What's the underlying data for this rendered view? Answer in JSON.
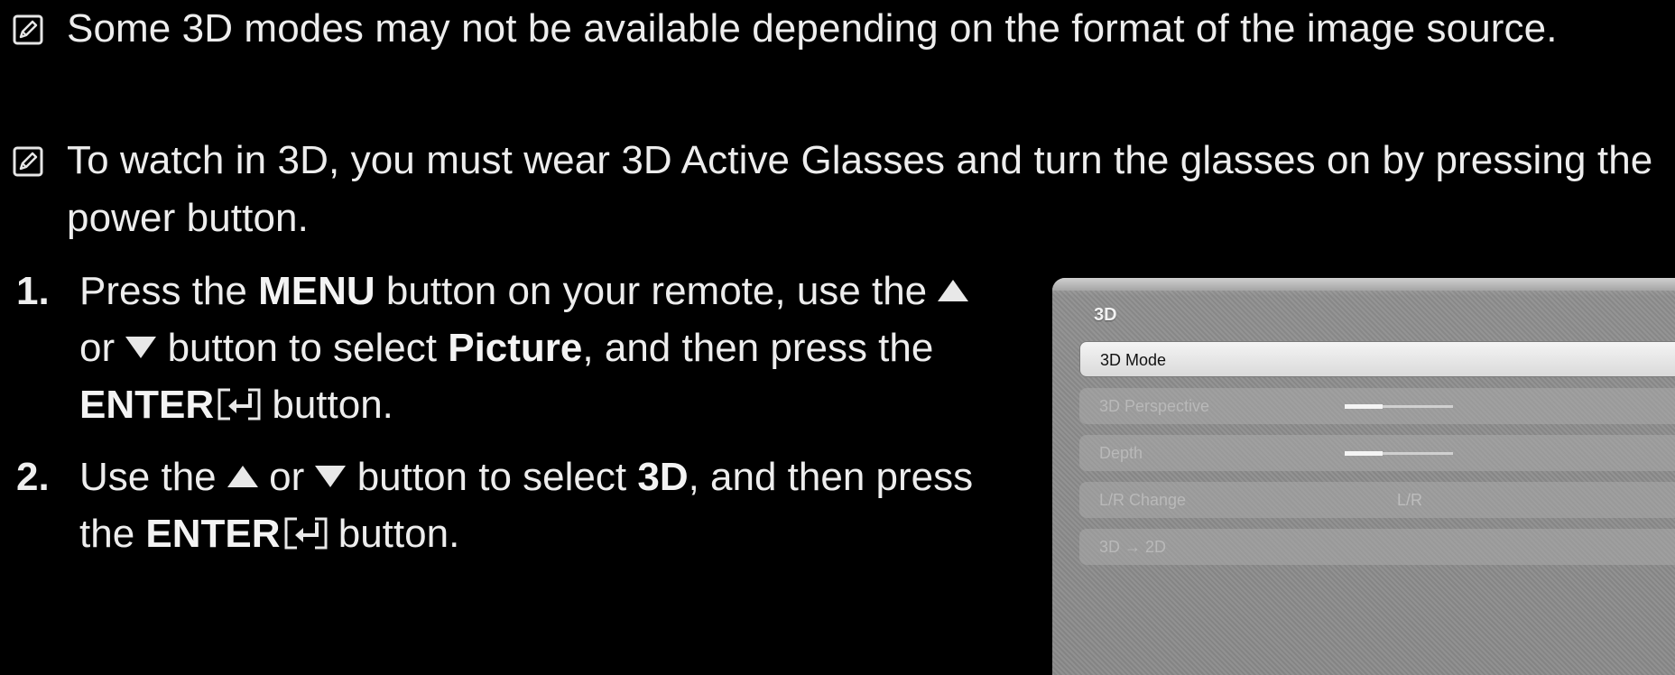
{
  "notes": [
    {
      "icon": "note-pencil-icon",
      "text": "Some 3D modes may not be available depending on the format of the image source."
    },
    {
      "icon": "note-pencil-icon",
      "text": "To watch in 3D, you must wear 3D Active Glasses and turn the glasses on by pressing the power button."
    }
  ],
  "steps": {
    "step1": {
      "number": "1.",
      "line1_a": "Press the ",
      "line1_b": "MENU",
      "line1_c": " button on your remote, use the",
      "line2_a": "or",
      "line2_b": " button to select ",
      "line2_c": "Picture",
      "line2_d": ", and then press the",
      "line3_a": "ENTER",
      "line3_b": " button."
    },
    "step2": {
      "number": "2.",
      "line1_a": "Use the",
      "line1_b": "or",
      "line1_c": " button to select ",
      "line1_d": "3D",
      "line1_e": ", and then press",
      "line2_a": "the ",
      "line2_b": "ENTER",
      "line2_c": " button."
    }
  },
  "menu_panel": {
    "title": "3D",
    "items": [
      {
        "label": "3D Mode",
        "selected": true
      },
      {
        "label": "3D Perspective",
        "slider": 0.35
      },
      {
        "label": "Depth",
        "slider": 0.35
      },
      {
        "label": "L/R Change",
        "value": "L/R"
      },
      {
        "label": "3D → 2D"
      }
    ]
  },
  "colors": {
    "background": "#000000",
    "text": "#ededed",
    "panel": "#8f8f8f"
  }
}
